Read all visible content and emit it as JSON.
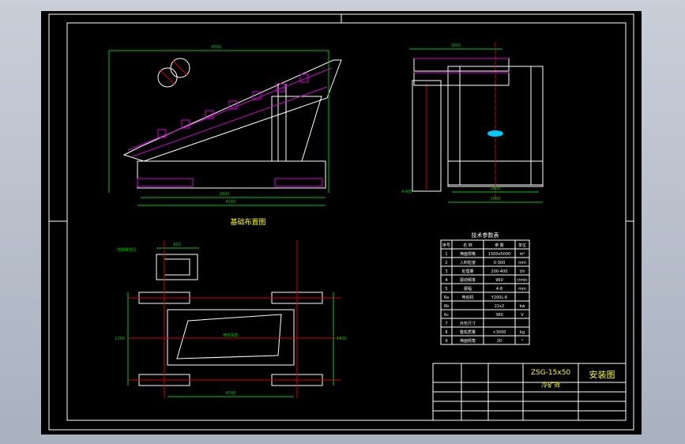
{
  "drawing": {
    "title_block": {
      "model": "ZSG-15x50",
      "name": "冷矿筛",
      "sheet_title": "安装图"
    },
    "front_view_caption": "基础布置图",
    "tech_table": {
      "title": "技术参数表",
      "headers": [
        "序号",
        "名 称",
        "参 数",
        "单位"
      ],
      "rows": [
        [
          "1",
          "筛面规格",
          "1500x5000",
          "m²"
        ],
        [
          "2",
          "入料粒度",
          "0-300",
          "mm"
        ],
        [
          "3",
          "处理量",
          "200-400",
          "t/h"
        ],
        [
          "4",
          "振动频率",
          "960",
          "r/min"
        ],
        [
          "5",
          "振幅",
          "4-8",
          "mm"
        ],
        [
          "6a",
          "电动机",
          "Y200L-6",
          ""
        ],
        [
          "6b",
          "",
          "22x2",
          "kw"
        ],
        [
          "6c",
          "",
          "380",
          "V"
        ],
        [
          "7",
          "外形尺寸",
          "",
          ""
        ],
        [
          "8",
          "整机质量",
          "<3000",
          "kg"
        ],
        [
          "9",
          "筛面倾角",
          "20",
          "°"
        ]
      ]
    },
    "dimensions": {
      "front_top": "4500",
      "front_bottom_1": "2600",
      "front_bottom_2": "4500",
      "side_top": "1800",
      "side_mid": "2600",
      "side_bottom": "2600",
      "plan_top": "600",
      "plan_bottom": "4500",
      "plan_left": "1300",
      "plan_right": "1800"
    },
    "labels": {
      "plan_inner": "筛体投影",
      "plan_note": "地脚螺栓孔",
      "side_mark": "A-A向"
    }
  }
}
